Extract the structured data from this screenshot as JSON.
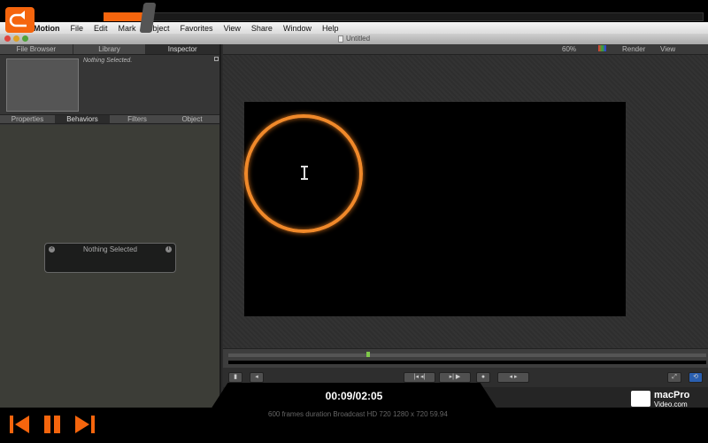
{
  "menubar": {
    "items": [
      "Motion",
      "File",
      "Edit",
      "Mark",
      "Object",
      "Favorites",
      "View",
      "Share",
      "Window",
      "Help"
    ]
  },
  "window": {
    "title": "Untitled"
  },
  "left_panel": {
    "top_tabs": [
      "File Browser",
      "Library",
      "Inspector"
    ],
    "preview_caption": "Nothing Selected.",
    "inspector_tabs": [
      "Properties",
      "Behaviors",
      "Filters",
      "Object"
    ],
    "hud_title": "Nothing Selected"
  },
  "canvas": {
    "zoom": "60%",
    "render_label": "Render",
    "view_label": "View",
    "stage_bg_color": "#000000",
    "ring_color": "#f0892a"
  },
  "status": {
    "text": "600 frames duration Broadcast HD 720 1280 x 720 59.94"
  },
  "player": {
    "time": "00:09/02:05",
    "progress": 0.072,
    "accent_color": "#f5650d"
  },
  "brand": {
    "line1": "macPro",
    "line2": "Video.com"
  },
  "icons": {
    "back": "back-arrow-icon",
    "skip_back": "skip-back-icon",
    "pause": "pause-icon",
    "skip_forward": "skip-forward-icon"
  }
}
